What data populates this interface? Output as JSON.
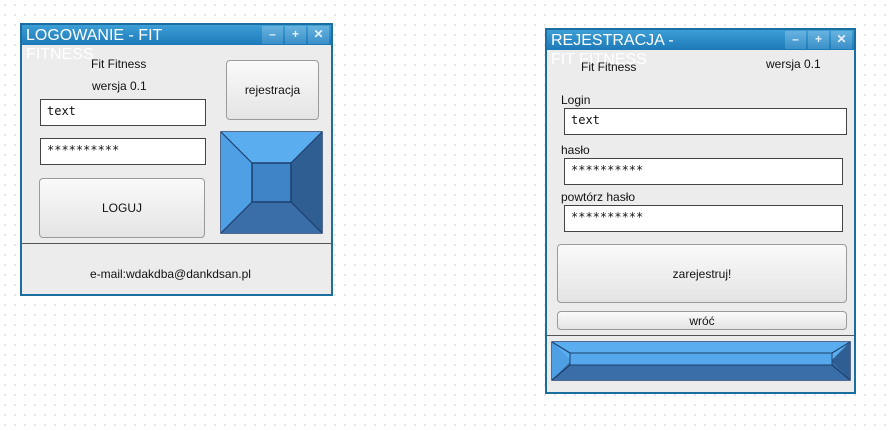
{
  "login": {
    "title": "LOGOWANIE - FIT FITNESS",
    "window_buttons": [
      "–",
      "+",
      "✕"
    ],
    "app_name": "Fit Fitness",
    "version": "wersja 0.1",
    "login_value": "text",
    "password_value": "**********",
    "login_button": "LOGUJ",
    "register_button": "rejestracja",
    "footer_email": "e-mail:wdakdba@dankdsan.pl"
  },
  "register": {
    "title": "REJESTRACJA - FIT FITNESS",
    "window_buttons": [
      "–",
      "+",
      "✕"
    ],
    "app_name": "Fit Fitness",
    "version": "wersja 0.1",
    "login_label": "Login",
    "login_value": "text",
    "password_label": "hasło",
    "password_value": "**********",
    "repeat_label": "powtórz hasło",
    "repeat_value": "**********",
    "submit_button": "zarejestruj!",
    "back_button": "wróć"
  },
  "colors": {
    "frame": "#1a6fa0",
    "image_light": "#56a8ec",
    "image_mid": "#3d82c4",
    "image_dark": "#2c5b8c"
  }
}
